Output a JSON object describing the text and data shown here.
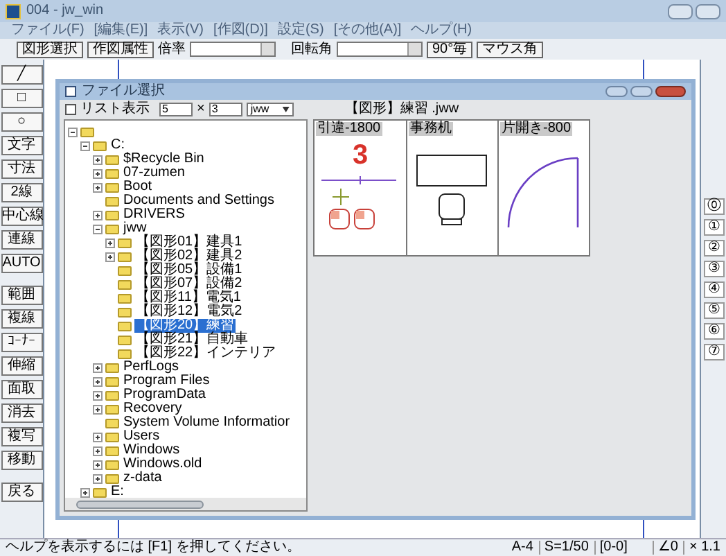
{
  "window": {
    "title": "004 - jw_win"
  },
  "menu": [
    {
      "label": "ファイル(F)"
    },
    {
      "label": "[編集(E)]"
    },
    {
      "label": "表示(V)"
    },
    {
      "label": "[作図(D)]"
    },
    {
      "label": "設定(S)"
    },
    {
      "label": "[その他(A)]"
    },
    {
      "label": "ヘルプ(H)"
    }
  ],
  "toolbar": {
    "buttons_left": [
      "図形選択",
      "作図属性"
    ],
    "scale_label": "倍率",
    "rotation_label": "回転角",
    "buttons_right": [
      "90°毎",
      "マウス角"
    ]
  },
  "left_tools": [
    {
      "label": "╱"
    },
    {
      "label": "□"
    },
    {
      "label": "○"
    },
    {
      "label": "文字"
    },
    {
      "label": "寸法"
    },
    {
      "label": "2線"
    },
    {
      "label": "中心線"
    },
    {
      "label": "連線"
    },
    {
      "label": "AUTO"
    },
    {
      "label": "範囲"
    },
    {
      "label": "複線"
    },
    {
      "label": "ｺｰﾅｰ"
    },
    {
      "label": "伸縮"
    },
    {
      "label": "面取"
    },
    {
      "label": "消去"
    },
    {
      "label": "複写"
    },
    {
      "label": "移動"
    },
    {
      "label": "戻る"
    }
  ],
  "right_tools": [
    "⓪",
    "①",
    "②",
    "③",
    "④",
    "⑤",
    "⑥",
    "⑦"
  ],
  "dialog": {
    "title": "ファイル選択",
    "list_view": {
      "label": "リスト表示",
      "checked": false
    },
    "columns": "5",
    "multiply": "×",
    "rows": "3",
    "extension": "jww",
    "folder_label": "【図形】練習 .jww",
    "tree": [
      {
        "expanded": true,
        "children": [
          {
            "label": "C:",
            "expanded": true,
            "children": [
              {
                "label": "$Recycle Bin",
                "expanded": false
              },
              {
                "label": "07-zumen",
                "expanded": false
              },
              {
                "label": "Boot",
                "expanded": false
              },
              {
                "label": "Documents and Settings"
              },
              {
                "label": "DRIVERS",
                "expanded": false
              },
              {
                "label": "jww",
                "expanded": true,
                "children": [
                  {
                    "label": "【図形01】建具1",
                    "expanded": false
                  },
                  {
                    "label": "【図形02】建具2",
                    "expanded": false
                  },
                  {
                    "label": "【図形05】設備1"
                  },
                  {
                    "label": "【図形07】設備2"
                  },
                  {
                    "label": "【図形11】電気1"
                  },
                  {
                    "label": "【図形12】電気2"
                  },
                  {
                    "label": "【図形20】練習",
                    "selected": true
                  },
                  {
                    "label": "【図形21】自動車"
                  },
                  {
                    "label": "【図形22】インテリア"
                  }
                ]
              },
              {
                "label": "PerfLogs",
                "expanded": false
              },
              {
                "label": "Program Files",
                "expanded": false
              },
              {
                "label": "ProgramData",
                "expanded": false
              },
              {
                "label": "Recovery",
                "expanded": false
              },
              {
                "label": "System Volume Informatior"
              },
              {
                "label": "Users",
                "expanded": false
              },
              {
                "label": "Windows",
                "expanded": false
              },
              {
                "label": "Windows.old",
                "expanded": false
              },
              {
                "label": "z-data",
                "expanded": false
              }
            ]
          },
          {
            "label": "E:",
            "expanded": false
          }
        ]
      }
    ],
    "thumbnails": [
      {
        "label": "引違-1800",
        "kind": "window",
        "number": "3"
      },
      {
        "label": "事務机",
        "kind": "desk"
      },
      {
        "label": "片開き-800",
        "kind": "door"
      }
    ]
  },
  "status_bar": {
    "help": "ヘルプを表示するには [F1] を押してください。",
    "paper": "A-4",
    "scale": "S=1/50",
    "layer": "[0-0]",
    "angle": "∠0",
    "zoom": "× 1.1"
  }
}
